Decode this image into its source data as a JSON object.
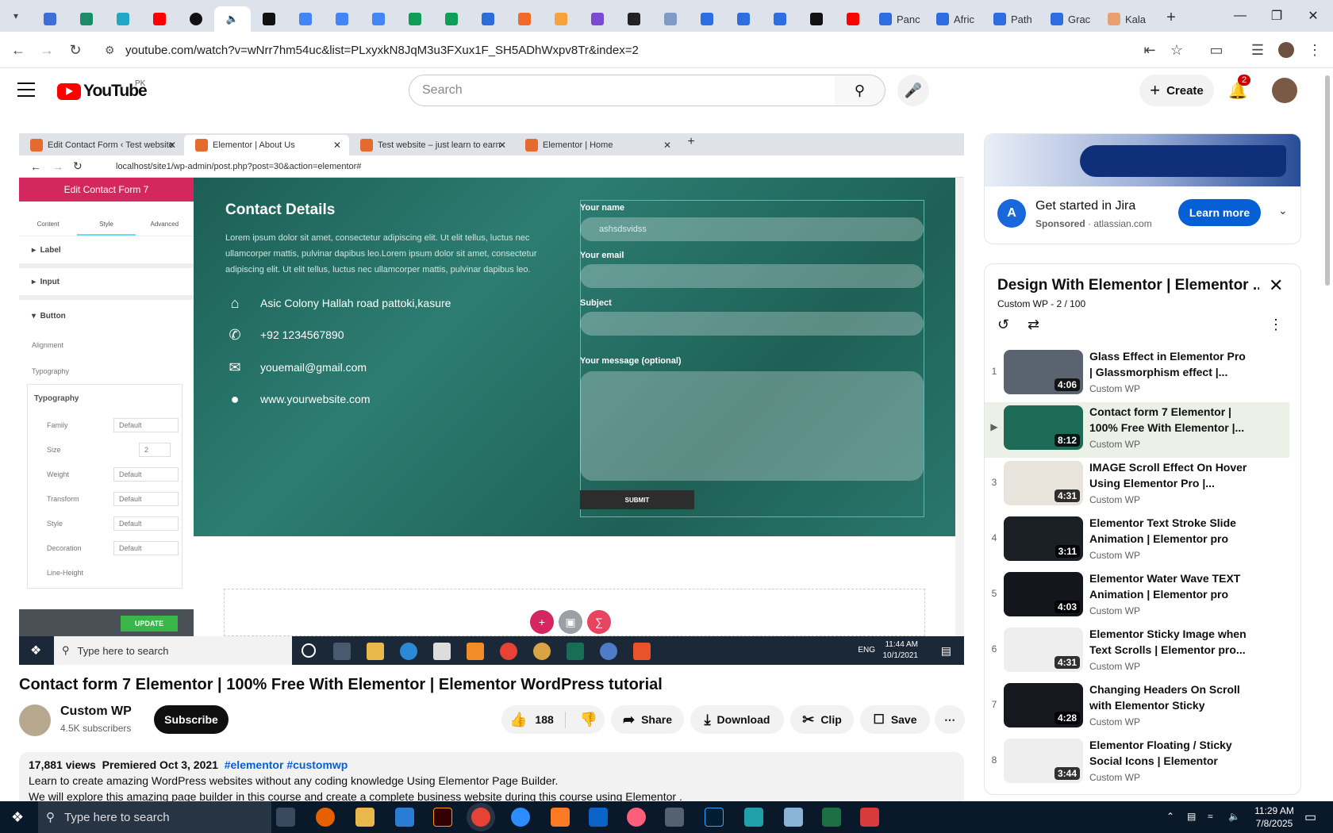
{
  "browser": {
    "tabs": [
      {
        "label": "Panc"
      },
      {
        "label": "Afric"
      },
      {
        "label": "Path"
      },
      {
        "label": "Grac"
      },
      {
        "label": "Kala"
      }
    ],
    "url": "youtube.com/watch?v=wNrr7hm54uc&list=PLxyxkN8JqM3u3FXux1F_SH5ADhWxpv8Tr&index=2"
  },
  "youtube": {
    "region": "PK",
    "search_placeholder": "Search",
    "create_label": "Create",
    "notif_count": "2"
  },
  "player": {
    "inner_tabs": [
      "Edit Contact Form ‹ Test website",
      "Elementor | About Us",
      "Test website – just learn to earn",
      "Elementor | Home"
    ],
    "inner_url": "localhost/site1/wp-admin/post.php?post=30&action=elementor#",
    "panel": {
      "title": "Edit Contact Form 7",
      "tabs": [
        "Content",
        "Style",
        "Advanced"
      ],
      "sections": [
        "Label",
        "Input",
        "Button"
      ],
      "alignment": "Alignment",
      "typography": "Typography",
      "typo_popup": "Typography",
      "rows": [
        {
          "label": "Family",
          "value": "Default"
        },
        {
          "label": "Size",
          "value": "2"
        },
        {
          "label": "Weight",
          "value": "Default"
        },
        {
          "label": "Transform",
          "value": "Default"
        },
        {
          "label": "Style",
          "value": "Default"
        },
        {
          "label": "Decoration",
          "value": "Default"
        },
        {
          "label": "Line-Height",
          "value": ""
        }
      ],
      "update": "UPDATE"
    },
    "page": {
      "title": "Contact Details",
      "lorem": "Lorem ipsum dolor sit amet, consectetur adipiscing elit. Ut elit tellus, luctus nec ullamcorper mattis, pulvinar dapibus leo.Lorem ipsum dolor sit amet, consectetur adipiscing elit. Ut elit tellus, luctus nec ullamcorper mattis, pulvinar dapibus leo.",
      "address": "Asic Colony Hallah road pattoki,kasure",
      "phone": "+92 1234567890",
      "email": "youemail@gmail.com",
      "website": "www.yourwebsite.com",
      "form": {
        "name_label": "Your name",
        "name_value": "ashsdsvidss",
        "email_label": "Your email",
        "subject_label": "Subject",
        "message_label": "Your message (optional)",
        "submit": "SUBMIT"
      }
    },
    "win_taskbar": {
      "search": "Type here to search",
      "lang": "ENG",
      "time": "11:44 AM",
      "date": "10/1/2021"
    }
  },
  "video": {
    "title": "Contact form 7 Elementor | 100% Free With Elementor | Elementor WordPress tutorial",
    "channel": "Custom WP",
    "subscribers": "4.5K subscribers",
    "subscribe": "Subscribe",
    "likes": "188",
    "share": "Share",
    "download": "Download",
    "clip": "Clip",
    "save": "Save",
    "views": "17,881 views",
    "premiered": "Premiered Oct 3, 2021",
    "tags": "#elementor #customwp",
    "desc1": "Learn to create amazing WordPress websites without any coding knowledge Using Elementor Page Builder.",
    "desc2": "We will explore this amazing page builder in this course and create a complete business website during this course using Elementor ."
  },
  "ad": {
    "headline": "Get started in Jira",
    "sponsored": "Sponsored",
    "domain": "atlassian.com",
    "cta": "Learn more"
  },
  "playlist": {
    "title": "Design With Elementor | Elementor ...",
    "meta": "Custom WP - 2 / 100",
    "items": [
      {
        "idx": "1",
        "title": "Glass Effect in Elementor Pro | Glassmorphism effect |...",
        "channel": "Custom WP",
        "duration": "4:06",
        "color": "#5a6470"
      },
      {
        "idx": "▶",
        "title": "Contact form 7 Elementor | 100% Free With Elementor |...",
        "channel": "Custom WP",
        "duration": "8:12",
        "color": "#1d6a57"
      },
      {
        "idx": "3",
        "title": "IMAGE Scroll Effect On Hover Using Elementor Pro |...",
        "channel": "Custom WP",
        "duration": "4:31",
        "color": "#e8e4dc"
      },
      {
        "idx": "4",
        "title": "Elementor Text Stroke Slide Animation | Elementor pro Tip...",
        "channel": "Custom WP",
        "duration": "3:11",
        "color": "#1b1f26"
      },
      {
        "idx": "5",
        "title": "Elementor Water Wave TEXT Animation | Elementor pro Tip...",
        "channel": "Custom WP",
        "duration": "4:03",
        "color": "#13161c"
      },
      {
        "idx": "6",
        "title": "Elementor Sticky Image when Text Scrolls | Elementor pro...",
        "channel": "Custom WP",
        "duration": "4:31",
        "color": "#eeeeee"
      },
      {
        "idx": "7",
        "title": "Changing Headers On Scroll with Elementor Sticky Header...",
        "channel": "Custom WP",
        "duration": "4:28",
        "color": "#15181e"
      },
      {
        "idx": "8",
        "title": "Elementor Floating / Sticky Social Icons | Elementor Pro...",
        "channel": "Custom WP",
        "duration": "3:44",
        "color": "#eeeeee"
      }
    ]
  },
  "taskbar": {
    "search": "Type here to search",
    "time": "11:29 AM",
    "date": "7/8/2025"
  }
}
